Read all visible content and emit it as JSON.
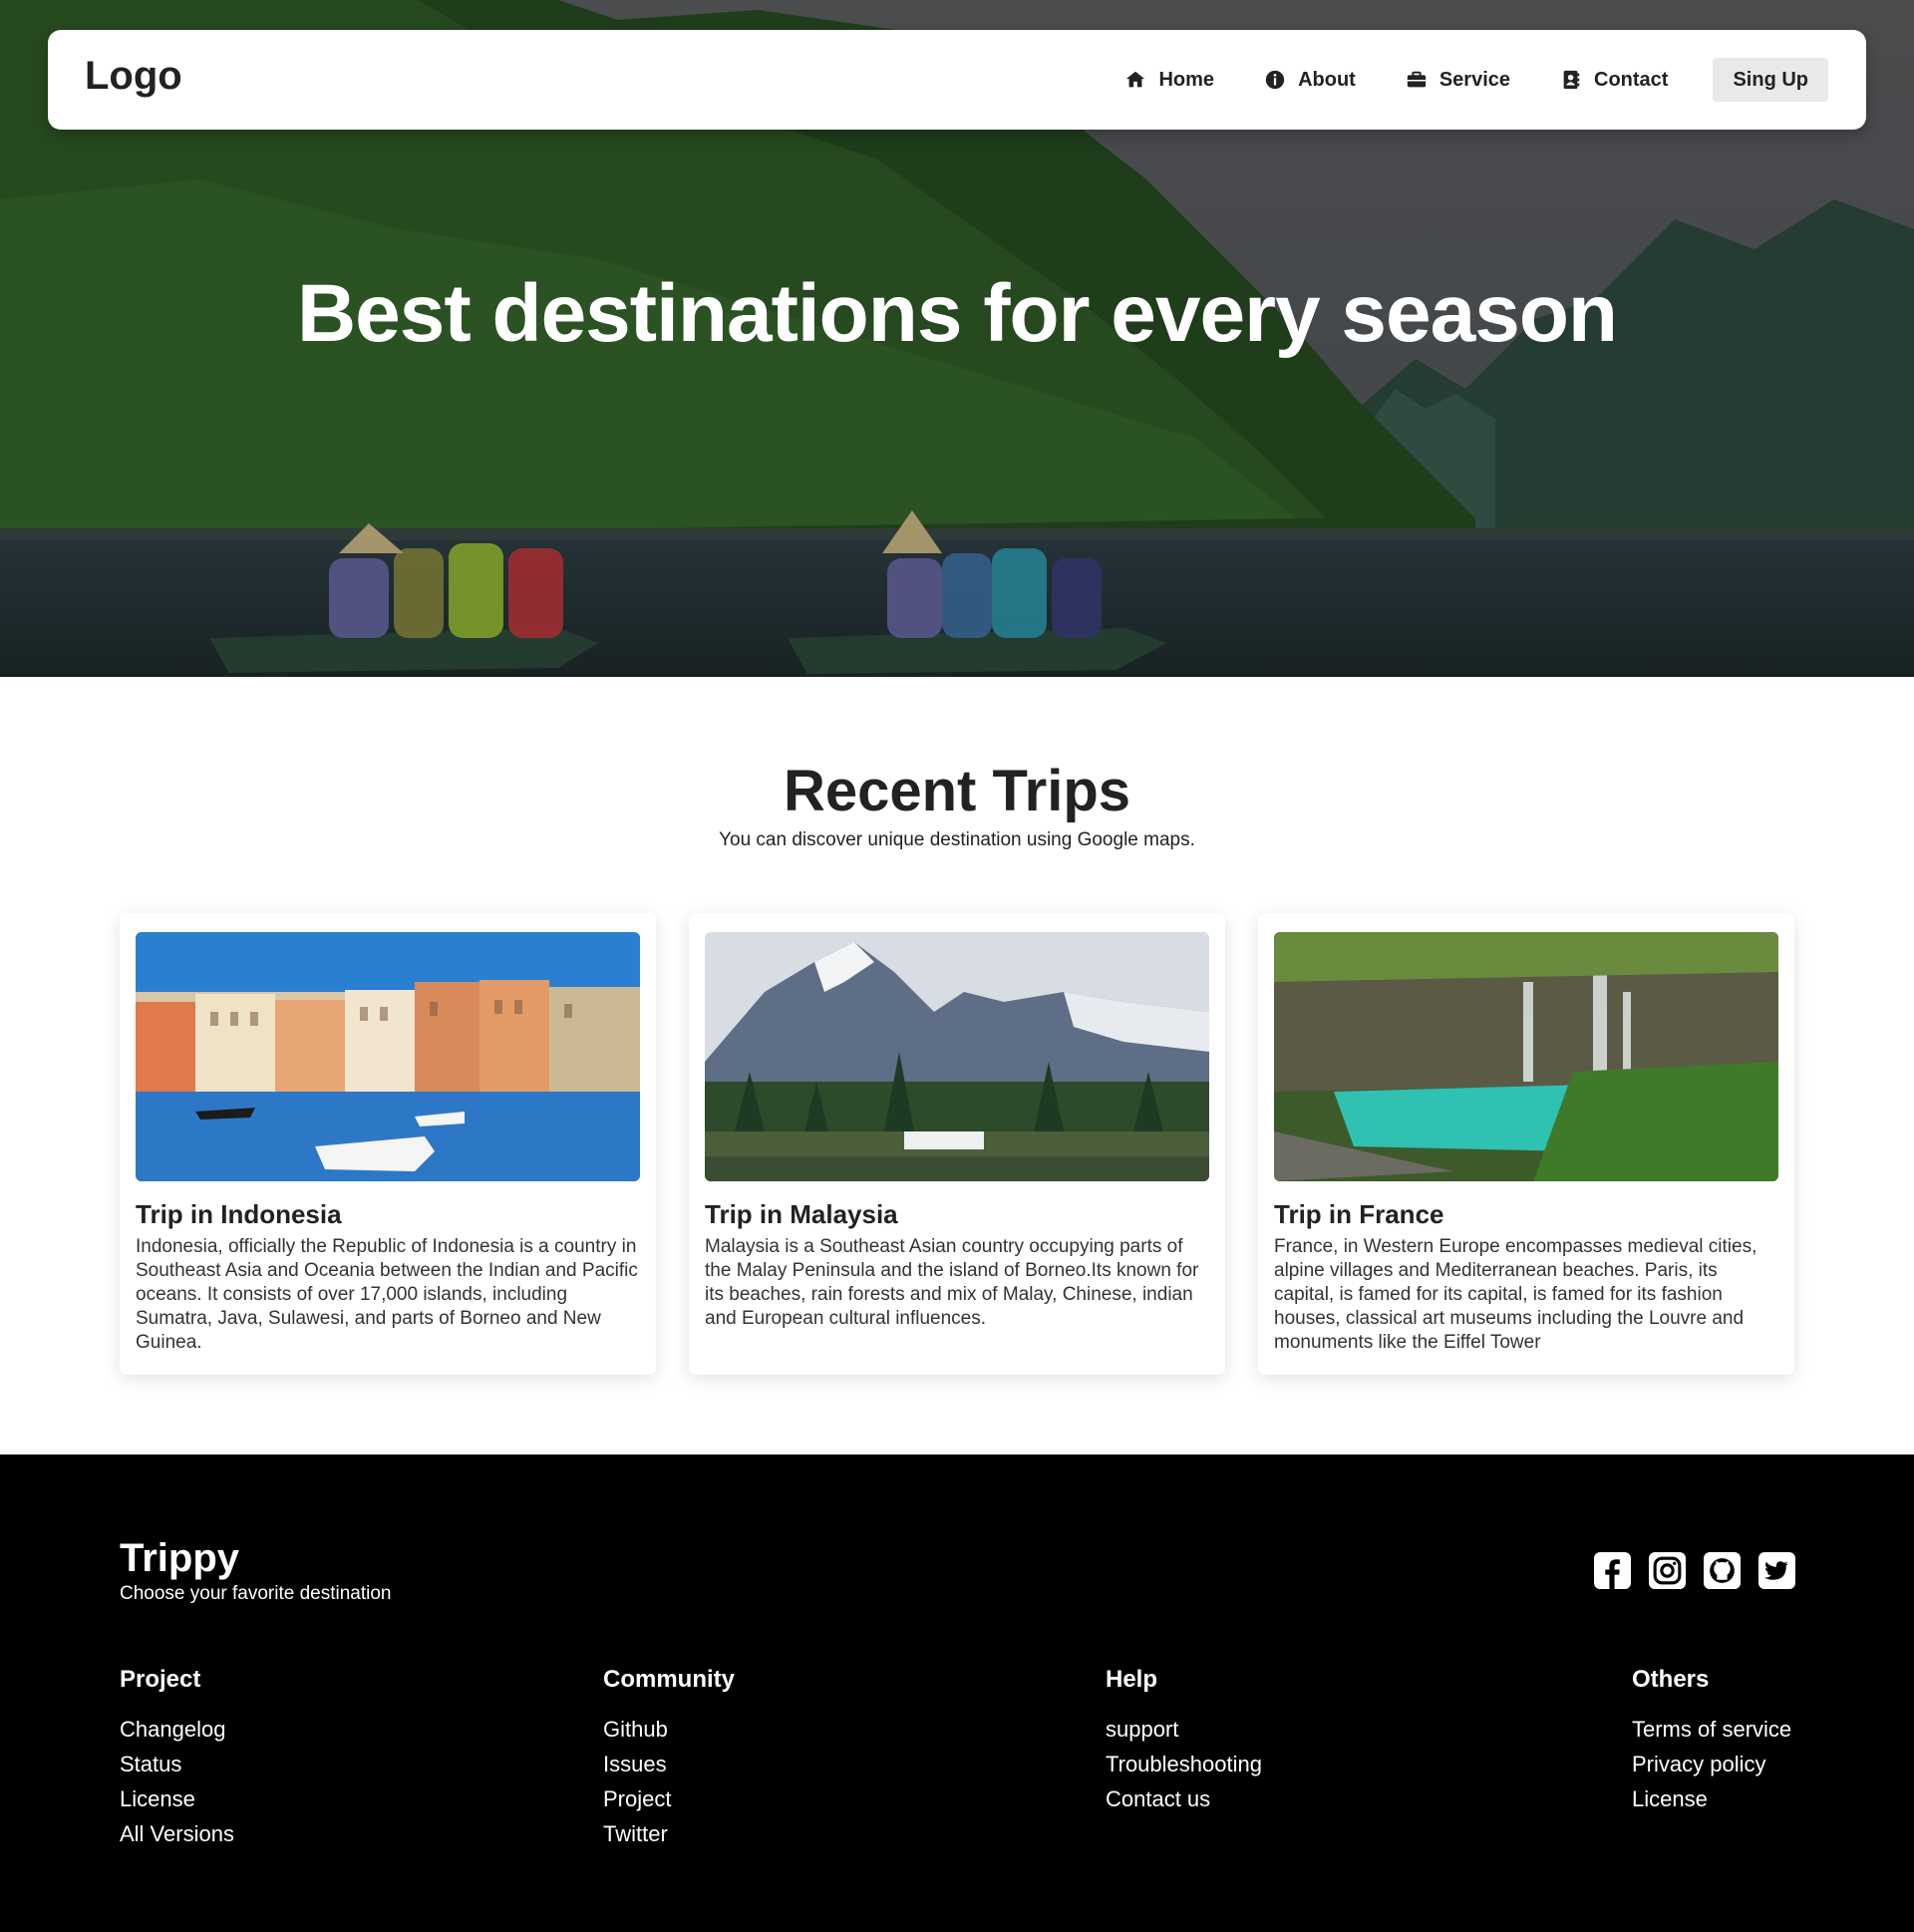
{
  "header": {
    "logo": "Logo",
    "nav": [
      {
        "label": "Home",
        "icon": "house-icon"
      },
      {
        "label": "About",
        "icon": "info-circle-icon"
      },
      {
        "label": "Service",
        "icon": "briefcase-icon"
      },
      {
        "label": "Contact",
        "icon": "address-book-icon"
      }
    ],
    "signup_label": "Sing Up"
  },
  "hero": {
    "title": "Best destinations for every season"
  },
  "trips": {
    "title": "Recent Trips",
    "subtitle": "You can discover unique destination using Google maps.",
    "cards": [
      {
        "title": "Trip in Indonesia",
        "text": "Indonesia, officially the Republic of Indonesia is a country in Southeast Asia and Oceania between the Indian and Pacific oceans. It consists of over 17,000 islands, including Sumatra, Java, Sulawesi, and parts of Borneo and New Guinea.",
        "image": "venice-canal-image"
      },
      {
        "title": "Trip in Malaysia",
        "text": "Malaysia is a Southeast Asian country occupying parts of the Malay Peninsula and the island of Borneo.Its known for its beaches, rain forests and mix of Malay, Chinese, indian and European cultural influences.",
        "image": "mountain-lake-image"
      },
      {
        "title": "Trip in France",
        "text": "France, in Western Europe encompasses medieval cities, alpine villages and Mediterranean beaches. Paris, its capital, is famed for its capital, is famed for its fashion houses, classical art museums including the Louvre and monuments like the Eiffel Tower",
        "image": "waterfall-lagoon-image"
      }
    ]
  },
  "footer": {
    "brand": "Trippy",
    "tagline": "Choose your favorite destination",
    "socials": [
      "facebook-icon",
      "instagram-icon",
      "github-icon",
      "twitter-icon"
    ],
    "columns": [
      {
        "title": "Project",
        "links": [
          "Changelog",
          "Status",
          "License",
          "All Versions"
        ]
      },
      {
        "title": "Community",
        "links": [
          "Github",
          "Issues",
          "Project",
          "Twitter"
        ]
      },
      {
        "title": "Help",
        "links": [
          "support",
          "Troubleshooting",
          "Contact us"
        ]
      },
      {
        "title": "Others",
        "links": [
          "Terms of service",
          "Privacy policy",
          "License"
        ]
      }
    ]
  },
  "colors": {
    "footer_bg": "#000000",
    "signup_bg": "#e9e9e9",
    "text": "#222222"
  }
}
